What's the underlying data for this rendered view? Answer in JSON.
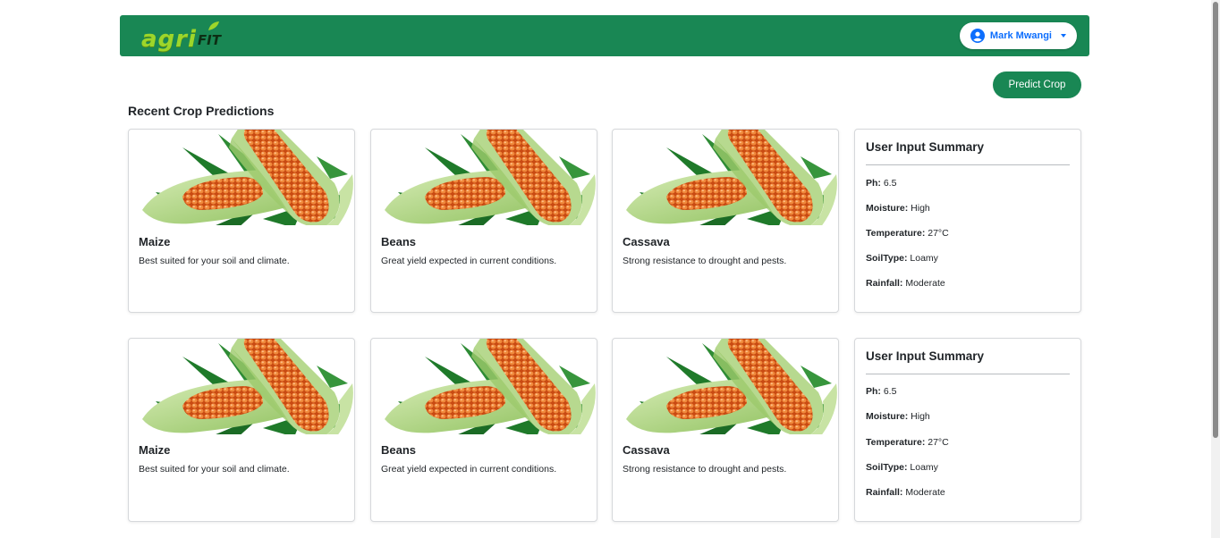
{
  "header": {
    "logo_part1": "agri",
    "logo_part2": "FIT",
    "user_name": "Mark Mwangi",
    "brand_color": "#198754"
  },
  "actions": {
    "predict_label": "Predict Crop"
  },
  "section": {
    "title": "Recent Crop Predictions"
  },
  "rows": [
    {
      "cards": [
        {
          "title": "Maize",
          "text": "Best suited for your soil and climate.",
          "image": "maize-image"
        },
        {
          "title": "Beans",
          "text": "Great yield expected in current conditions.",
          "image": "maize-image"
        },
        {
          "title": "Cassava",
          "text": "Strong resistance to drought and pests.",
          "image": "maize-image"
        }
      ],
      "summary": {
        "title": "User Input Summary",
        "items": [
          {
            "label": "Ph:",
            "value": "6.5"
          },
          {
            "label": "Moisture:",
            "value": "High"
          },
          {
            "label": "Temperature:",
            "value": "27°C"
          },
          {
            "label": "SoilType:",
            "value": "Loamy"
          },
          {
            "label": "Rainfall:",
            "value": "Moderate"
          }
        ]
      }
    },
    {
      "cards": [
        {
          "title": "Maize",
          "text": "Best suited for your soil and climate.",
          "image": "maize-image"
        },
        {
          "title": "Beans",
          "text": "Great yield expected in current conditions.",
          "image": "maize-image"
        },
        {
          "title": "Cassava",
          "text": "Strong resistance to drought and pests.",
          "image": "maize-image"
        }
      ],
      "summary": {
        "title": "User Input Summary",
        "items": [
          {
            "label": "Ph:",
            "value": "6.5"
          },
          {
            "label": "Moisture:",
            "value": "High"
          },
          {
            "label": "Temperature:",
            "value": "27°C"
          },
          {
            "label": "SoilType:",
            "value": "Loamy"
          },
          {
            "label": "Rainfall:",
            "value": "Moderate"
          }
        ]
      }
    }
  ]
}
